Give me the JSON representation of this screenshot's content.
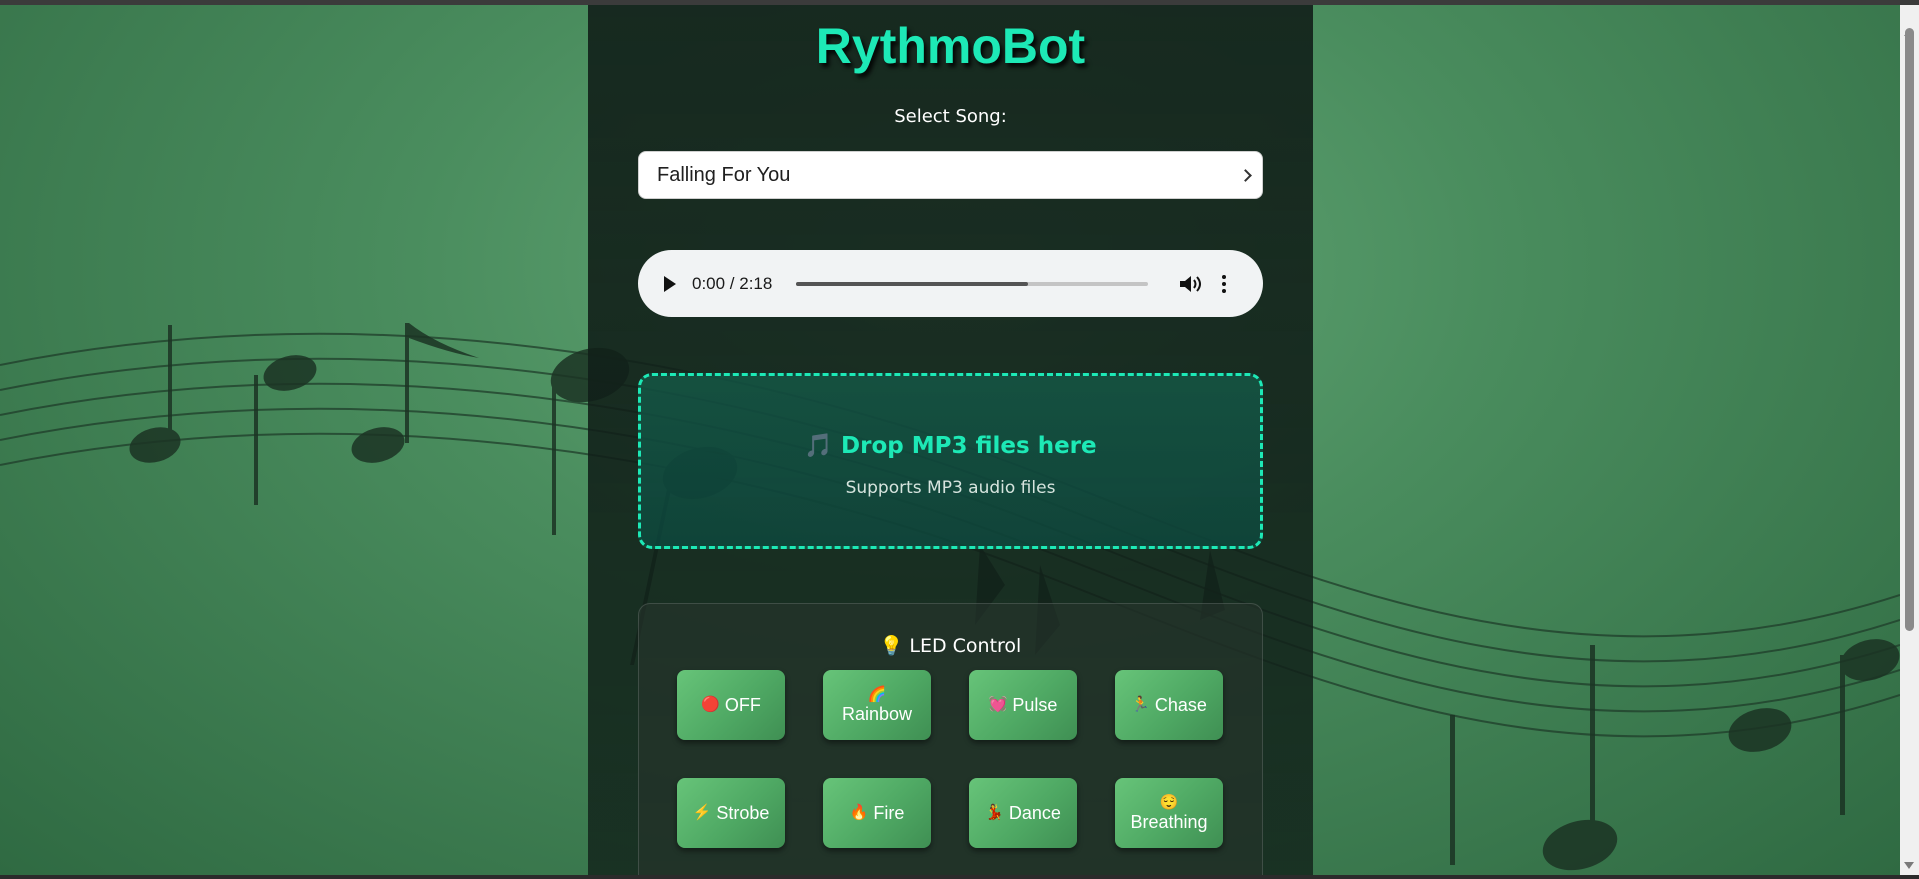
{
  "app": {
    "title": "RythmoBot"
  },
  "song_select": {
    "label": "Select Song:",
    "selected": "Falling For You"
  },
  "audio_player": {
    "time": "0:00 / 2:18",
    "progress_fraction": 0.66
  },
  "dropzone": {
    "icon": "🎵",
    "title": "Drop MP3 files here",
    "subtitle": "Supports MP3 audio files",
    "accent_color": "#1de9b6"
  },
  "led_control": {
    "icon": "💡",
    "title": "LED Control",
    "buttons": [
      {
        "label": "OFF",
        "icon": "🔴"
      },
      {
        "label": "Rainbow",
        "icon": "🌈"
      },
      {
        "label": "Pulse",
        "icon": "💓"
      },
      {
        "label": "Chase",
        "icon": "🏃"
      },
      {
        "label": "Strobe",
        "icon": "⚡"
      },
      {
        "label": "Fire",
        "icon": "🔥"
      },
      {
        "label": "Dance",
        "icon": "💃"
      },
      {
        "label": "Breathing",
        "icon": "😌"
      }
    ]
  },
  "colors": {
    "title": "#1de9b6",
    "button_green": "#4fa964",
    "panel": "#14241c"
  }
}
